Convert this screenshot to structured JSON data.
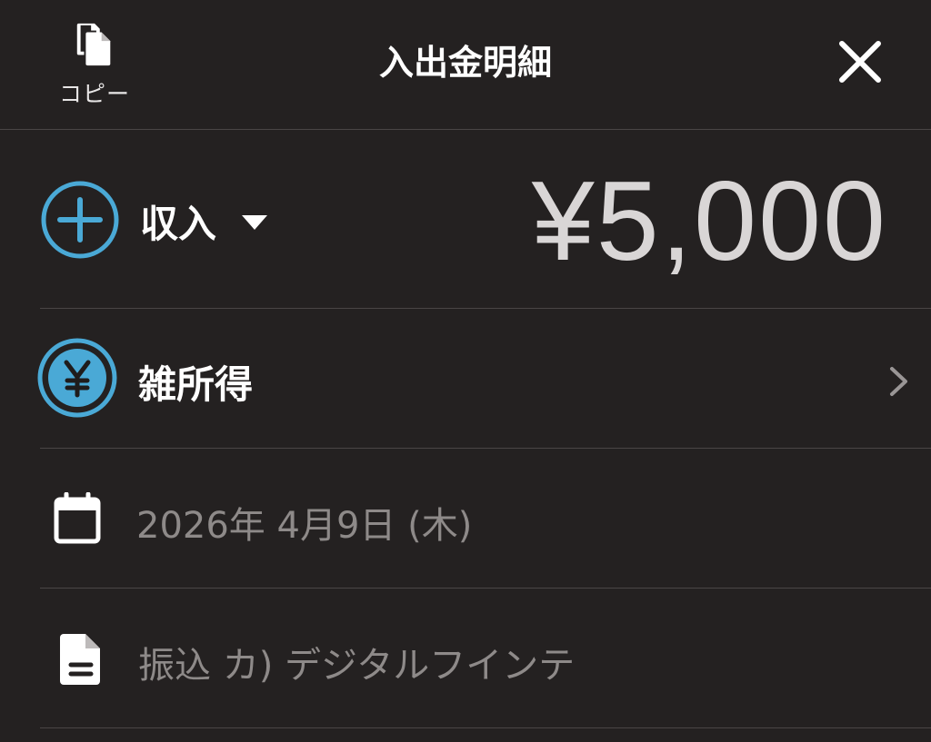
{
  "header": {
    "copy_label": "コピー",
    "title": "入出金明細",
    "copy_icon": "copy-icon",
    "close_icon": "close-icon"
  },
  "transaction": {
    "type_label": "収入",
    "type_icon": "plus-circle-icon",
    "amount": "¥5,000",
    "category_label": "雑所得",
    "category_icon": "yen-coin-icon",
    "date": "2026年 4月9日 (木)",
    "memo": "振込 カ) デジタルフインテ"
  },
  "colors": {
    "background": "#242121",
    "accent": "#4aa9d6",
    "muted_text": "#8e8a89",
    "amount_text": "#d9d6d6",
    "divider": "#4a4646"
  }
}
